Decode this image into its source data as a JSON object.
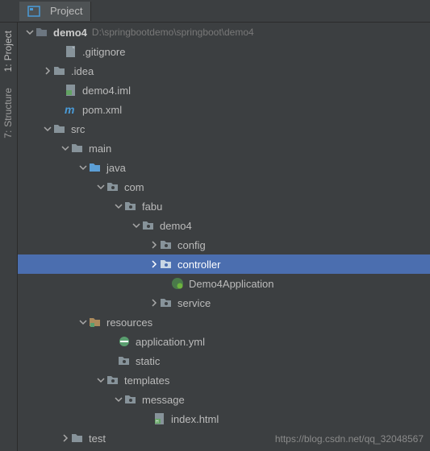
{
  "tab": {
    "label": "Project"
  },
  "sideTabs": {
    "project": {
      "prefix": "1:",
      "label": "Project"
    },
    "structure": {
      "prefix": "7:",
      "label": "Structure"
    }
  },
  "tree": {
    "root": {
      "name": "demo4",
      "path": "D:\\springbootdemo\\springboot\\demo4"
    },
    "gitignore": ".gitignore",
    "idea": ".idea",
    "iml": "demo4.iml",
    "pom": "pom.xml",
    "src": "src",
    "main": "main",
    "java": "java",
    "com": "com",
    "fabu": "fabu",
    "demo4": "demo4",
    "config": "config",
    "controller": "controller",
    "appClass": "Demo4Application",
    "service": "service",
    "resources": "resources",
    "appYml": "application.yml",
    "static": "static",
    "templates": "templates",
    "message": "message",
    "indexHtml": "index.html",
    "test": "test"
  },
  "watermark": "https://blog.csdn.net/qq_32048567"
}
